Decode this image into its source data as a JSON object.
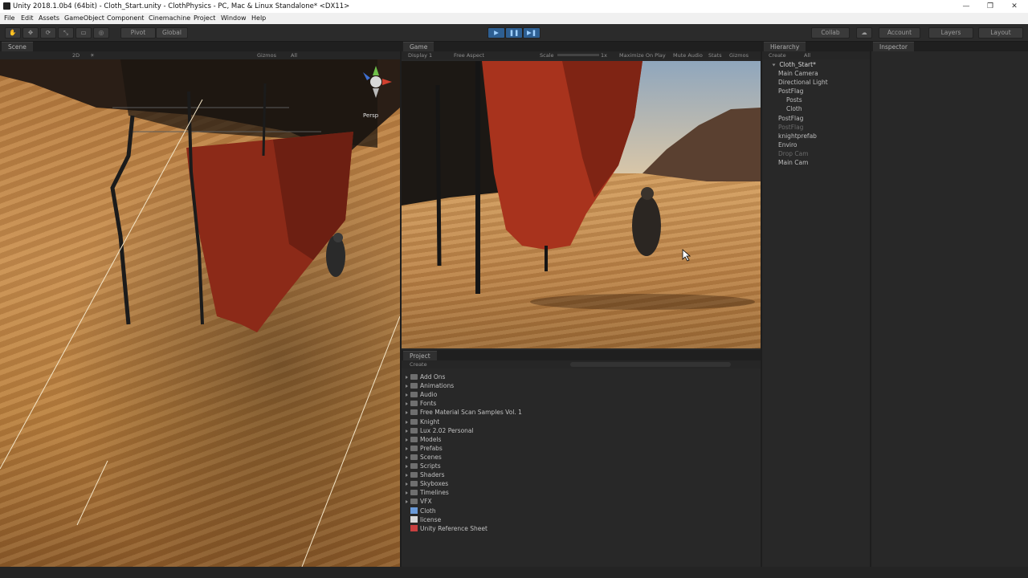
{
  "window": {
    "title": "Unity 2018.1.0b4 (64bit) - Cloth_Start.unity - ClothPhysics - PC, Mac & Linux Standalone* <DX11>",
    "controls": {
      "minimize": "—",
      "restore": "❐",
      "close": "✕"
    }
  },
  "menu": [
    "File",
    "Edit",
    "Assets",
    "GameObject",
    "Component",
    "Cinemachine",
    "Project",
    "Window",
    "Help"
  ],
  "toolbar": {
    "pivot": "Pivot",
    "global": "Global",
    "play_icon": "▶",
    "pause_icon": "❚❚",
    "step_icon": "▶❚",
    "collab": "Collab",
    "account": "Account",
    "layers": "Layers",
    "layout": "Layout"
  },
  "scene": {
    "tab": "Scene",
    "mode_2d": "2D",
    "gizmos": "Gizmos",
    "search": "All",
    "persp": "Persp"
  },
  "game": {
    "tab": "Game",
    "display": "Display 1",
    "aspect": "Free Aspect",
    "scale_label": "Scale",
    "scale_value": "1x",
    "maximize": "Maximize On Play",
    "mute": "Mute Audio",
    "stats": "Stats",
    "gizmos": "Gizmos"
  },
  "hierarchy": {
    "tab": "Hierarchy",
    "create": "Create",
    "search": "All",
    "scene_name": "Cloth_Start*",
    "items": [
      {
        "label": "Main Camera",
        "dim": false,
        "indent": 0
      },
      {
        "label": "Directional Light",
        "dim": false,
        "indent": 0
      },
      {
        "label": "PostFlag",
        "dim": false,
        "indent": 0
      },
      {
        "label": "Posts",
        "dim": false,
        "indent": 1
      },
      {
        "label": "Cloth",
        "dim": false,
        "indent": 1
      },
      {
        "label": "PostFlag",
        "dim": false,
        "indent": 0
      },
      {
        "label": "PostFlag",
        "dim": true,
        "indent": 0
      },
      {
        "label": "knightprefab",
        "dim": false,
        "indent": 0
      },
      {
        "label": "Enviro",
        "dim": false,
        "indent": 0
      },
      {
        "label": "Drop Cam",
        "dim": true,
        "indent": 0
      },
      {
        "label": "Main Cam",
        "dim": false,
        "indent": 0
      }
    ]
  },
  "inspector": {
    "tab": "Inspector"
  },
  "project": {
    "tab": "Project",
    "create": "Create",
    "items": [
      {
        "label": "Add Ons",
        "type": "folder"
      },
      {
        "label": "Animations",
        "type": "folder"
      },
      {
        "label": "Audio",
        "type": "folder"
      },
      {
        "label": "Fonts",
        "type": "folder"
      },
      {
        "label": "Free Material Scan Samples Vol. 1",
        "type": "folder"
      },
      {
        "label": "Knight",
        "type": "folder"
      },
      {
        "label": "Lux 2.02 Personal",
        "type": "folder"
      },
      {
        "label": "Models",
        "type": "folder"
      },
      {
        "label": "Prefabs",
        "type": "folder"
      },
      {
        "label": "Scenes",
        "type": "folder"
      },
      {
        "label": "Scripts",
        "type": "folder"
      },
      {
        "label": "Shaders",
        "type": "folder"
      },
      {
        "label": "Skyboxes",
        "type": "folder"
      },
      {
        "label": "Timelines",
        "type": "folder"
      },
      {
        "label": "VFX",
        "type": "folder"
      },
      {
        "label": "Cloth",
        "type": "scene"
      },
      {
        "label": "license",
        "type": "text"
      },
      {
        "label": "Unity Reference Sheet",
        "type": "pdf"
      }
    ]
  },
  "colors": {
    "play_active": "#2e5f92",
    "flag_red": "#9a2d1c",
    "sand": "#c88f50"
  }
}
